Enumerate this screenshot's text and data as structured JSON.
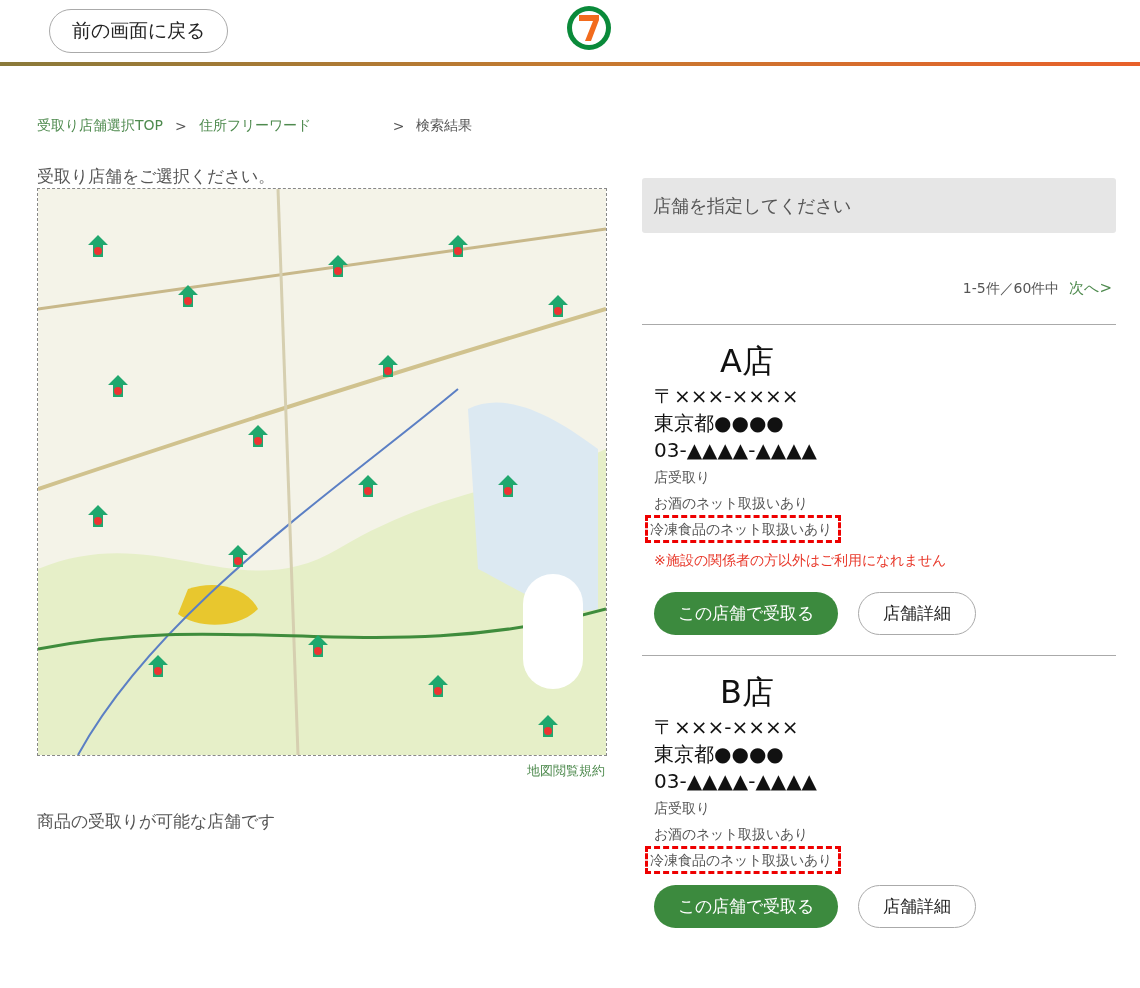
{
  "header": {
    "back_button": "前の画面に戻る"
  },
  "breadcrumb": [
    {
      "label": "受取り店舗選択TOP",
      "kind": "link"
    },
    {
      "label": "住所フリーワード",
      "kind": "link"
    },
    {
      "label": "検索結果",
      "kind": "current"
    }
  ],
  "breadcrumb_separator": ">",
  "prompt": "受取り店舗をご選択ください。",
  "map": {
    "kind": "picture",
    "terms_link": "地図閲覧規約"
  },
  "map_note": "商品の受取りが可能な店舗です",
  "search": {
    "placeholder": "店舗を指定してください"
  },
  "pagination": {
    "range": "1-5件／60件中",
    "next": "次へ>"
  },
  "stores": [
    {
      "name": "A店",
      "postal": "〒×××-××××",
      "address": "東京都●●●●",
      "phone": "03-▲▲▲▲-▲▲▲▲",
      "features": [
        {
          "label": "店受取り",
          "highlighted": false
        },
        {
          "label": "お酒のネット取扱いあり",
          "highlighted": false
        },
        {
          "label": "冷凍食品のネット取扱いあり",
          "highlighted": true
        }
      ],
      "notice": "※施設の関係者の方以外はご利用になれません",
      "select_button": "この店舗で受取る",
      "detail_button": "店舗詳細"
    },
    {
      "name": "B店",
      "postal": "〒×××-××××",
      "address": "東京都●●●●",
      "phone": "03-▲▲▲▲-▲▲▲▲",
      "features": [
        {
          "label": "店受取り",
          "highlighted": false
        },
        {
          "label": "お酒のネット取扱いあり",
          "highlighted": false
        },
        {
          "label": "冷凍食品のネット取扱いあり",
          "highlighted": true
        }
      ],
      "select_button": "この店舗で受取る",
      "detail_button": "店舗詳細"
    }
  ]
}
